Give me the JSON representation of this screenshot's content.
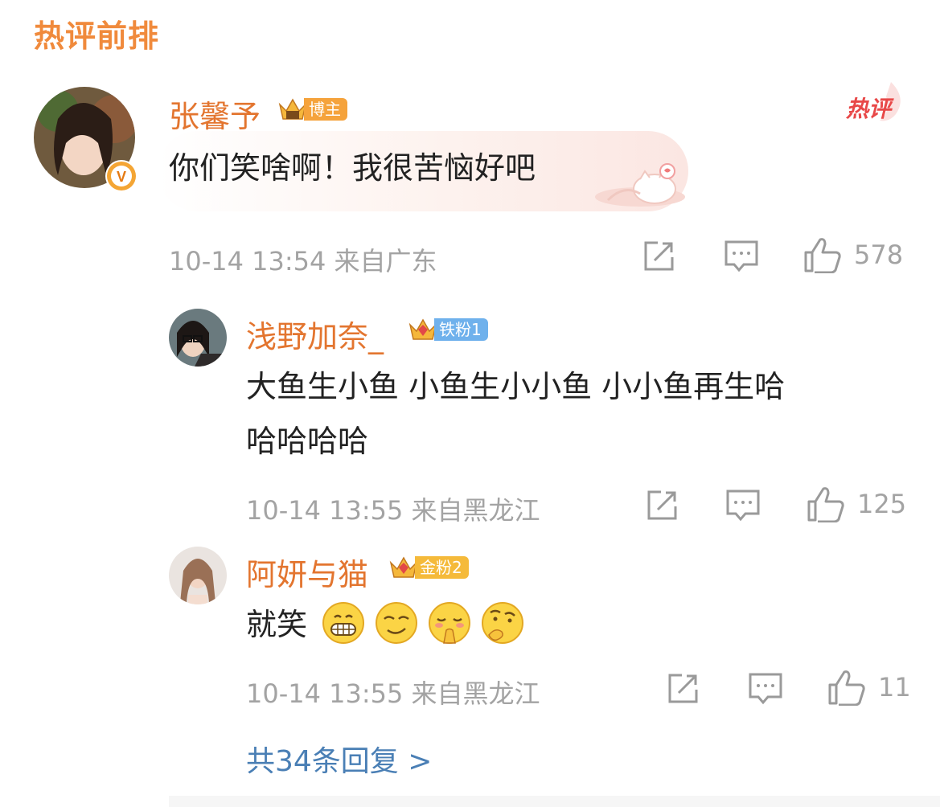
{
  "section": {
    "title": "热评前排"
  },
  "comments": [
    {
      "user": "张馨予",
      "badge": "博主",
      "text": "你们笑啥啊！我很苦恼好吧",
      "time": "10-14 13:54",
      "location": "来自广东",
      "likes": "578",
      "hot_tag": "热评",
      "verified_mark": "V"
    },
    {
      "user": "浅野加奈_",
      "badge": "铁粉1",
      "text_lines": [
        "大鱼生小鱼 小鱼生小小鱼 小小鱼再生哈",
        "哈哈哈哈"
      ],
      "time": "10-14 13:55",
      "location": "来自黑龙江",
      "likes": "125"
    },
    {
      "user": "阿妍与猫",
      "badge": "金粉2",
      "text": "就笑",
      "emojis": [
        "grin-icon",
        "smirk-icon",
        "shy-icon",
        "thinking-icon"
      ],
      "time": "10-14 13:55",
      "location": "来自黑龙江",
      "likes": "11"
    }
  ],
  "more_replies": "共34条回复 >",
  "colors": {
    "username": "#e3752f",
    "title": "#f08a3c",
    "link": "#4a7fb5",
    "meta": "#a3a3a3"
  }
}
